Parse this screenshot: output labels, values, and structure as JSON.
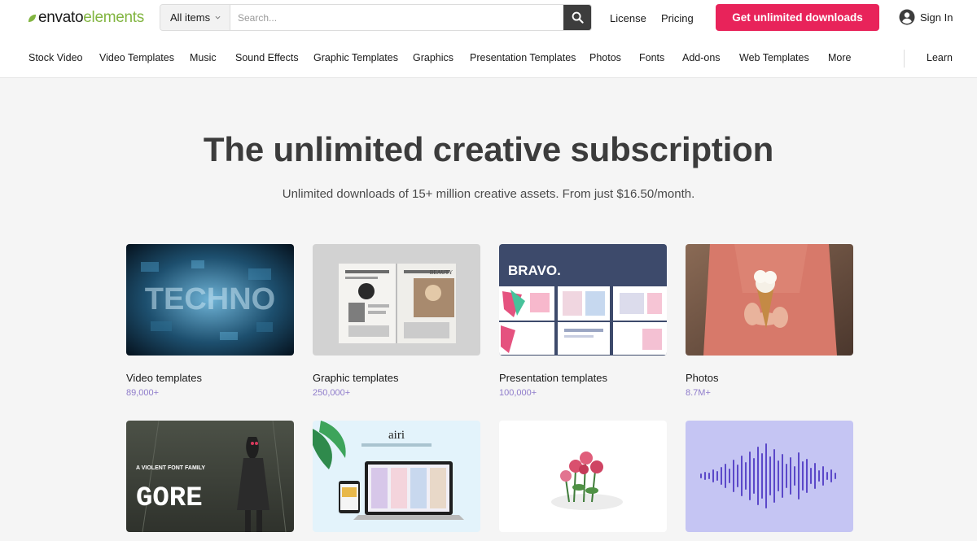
{
  "brand": {
    "name_part1": "envato",
    "name_part2": "elements"
  },
  "search": {
    "category_label": "All items",
    "placeholder": "Search..."
  },
  "header_links": {
    "license": "License",
    "pricing": "Pricing"
  },
  "cta": {
    "label": "Get unlimited downloads"
  },
  "signin": {
    "label": "Sign In"
  },
  "nav": {
    "items": [
      "Stock Video",
      "Video Templates",
      "Music",
      "Sound Effects",
      "Graphic Templates",
      "Graphics",
      "Presentation Templates",
      "Photos",
      "Fonts",
      "Add-ons",
      "Web Templates",
      "More"
    ],
    "learn": "Learn"
  },
  "hero": {
    "title": "The unlimited creative subscription",
    "subtitle": "Unlimited downloads of 15+ million creative assets. From just $16.50/month."
  },
  "categories": [
    {
      "label": "Video templates",
      "count": "89,000+",
      "thumb_text": "TECHNO"
    },
    {
      "label": "Graphic templates",
      "count": "250,000+",
      "thumb_text": "BEAUTY"
    },
    {
      "label": "Presentation templates",
      "count": "100,000+",
      "thumb_text": "BRAVO."
    },
    {
      "label": "Photos",
      "count": "8.7M+"
    },
    {
      "thumb_text": "GORE",
      "thumb_subtext": "A VIOLENT FONT FAMILY"
    },
    {
      "thumb_text": "airi"
    },
    {},
    {}
  ],
  "colors": {
    "accent": "#e8235a",
    "brand_green": "#82b541",
    "count_purple": "#8f7ccb",
    "dark_button": "#3d3d3d"
  },
  "icons": {
    "search": "search-icon",
    "chevron": "chevron-down-icon",
    "user": "user-circle-icon",
    "leaf": "leaf-icon"
  }
}
